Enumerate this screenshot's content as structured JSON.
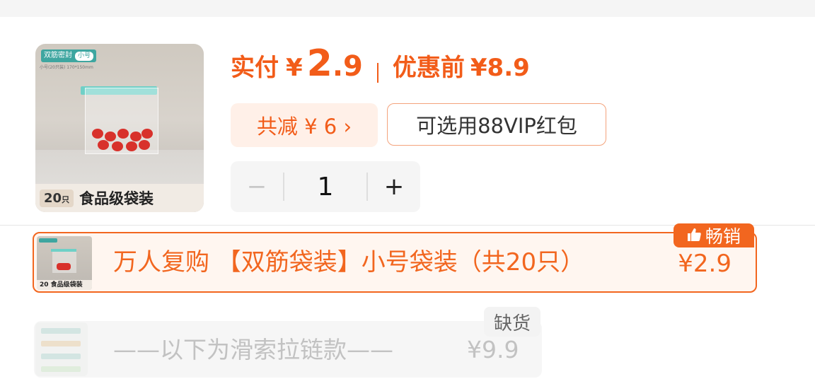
{
  "product": {
    "image": {
      "tag": "双筋密封",
      "size_tag": "小号",
      "spec": "小号(20只装) 170*150mm",
      "count": "20",
      "count_unit": "只",
      "caption": "食品级袋装"
    },
    "price": {
      "pay_label": "实付",
      "currency": "¥",
      "pay_integer": "2",
      "pay_decimal": ".9",
      "original_label": "优惠前",
      "original_price": "¥8.9"
    },
    "discount_text": "共减 ¥ 6 ›",
    "vip_text": "可选用88VIP红包",
    "quantity": {
      "minus": "−",
      "value": "1",
      "plus": "+"
    }
  },
  "skus": [
    {
      "name": "万人复购  【双筋袋装】小号袋装（共20只）",
      "price": "¥2.9",
      "badge": "畅销",
      "thumb_caption": "20 食品级袋装",
      "selected": true
    },
    {
      "name": "——以下为滑索拉链款——",
      "price": "¥9.9",
      "badge": "缺货",
      "selected": false
    }
  ],
  "colors": {
    "accent": "#f25c19",
    "selected_bg": "#fff6f0",
    "discount_bg": "#fff0e8",
    "disabled_text": "#c2c2c2"
  },
  "icons": [
    "thumbs-up-icon"
  ]
}
